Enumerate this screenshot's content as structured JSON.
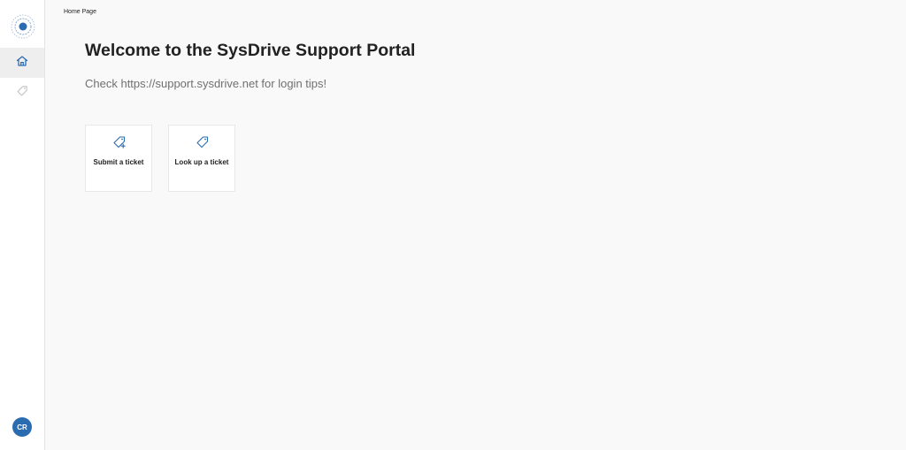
{
  "sidebar": {
    "items": [
      {
        "name": "home",
        "icon": "home-icon",
        "active": true
      },
      {
        "name": "tickets",
        "icon": "tag-icon",
        "active": false
      }
    ],
    "avatar_initials": "CR"
  },
  "breadcrumb": "Home Page",
  "main": {
    "title": "Welcome to the SysDrive Support Portal",
    "subtitle": "Check https://support.sysdrive.net for login tips!",
    "cards": [
      {
        "label": "Submit a ticket",
        "icon": "tag-plus-icon"
      },
      {
        "label": "Look up a ticket",
        "icon": "tag-icon"
      }
    ]
  },
  "colors": {
    "accent": "#2b6cb0",
    "background": "#f9f9f9",
    "sidebar_background": "#ffffff"
  }
}
